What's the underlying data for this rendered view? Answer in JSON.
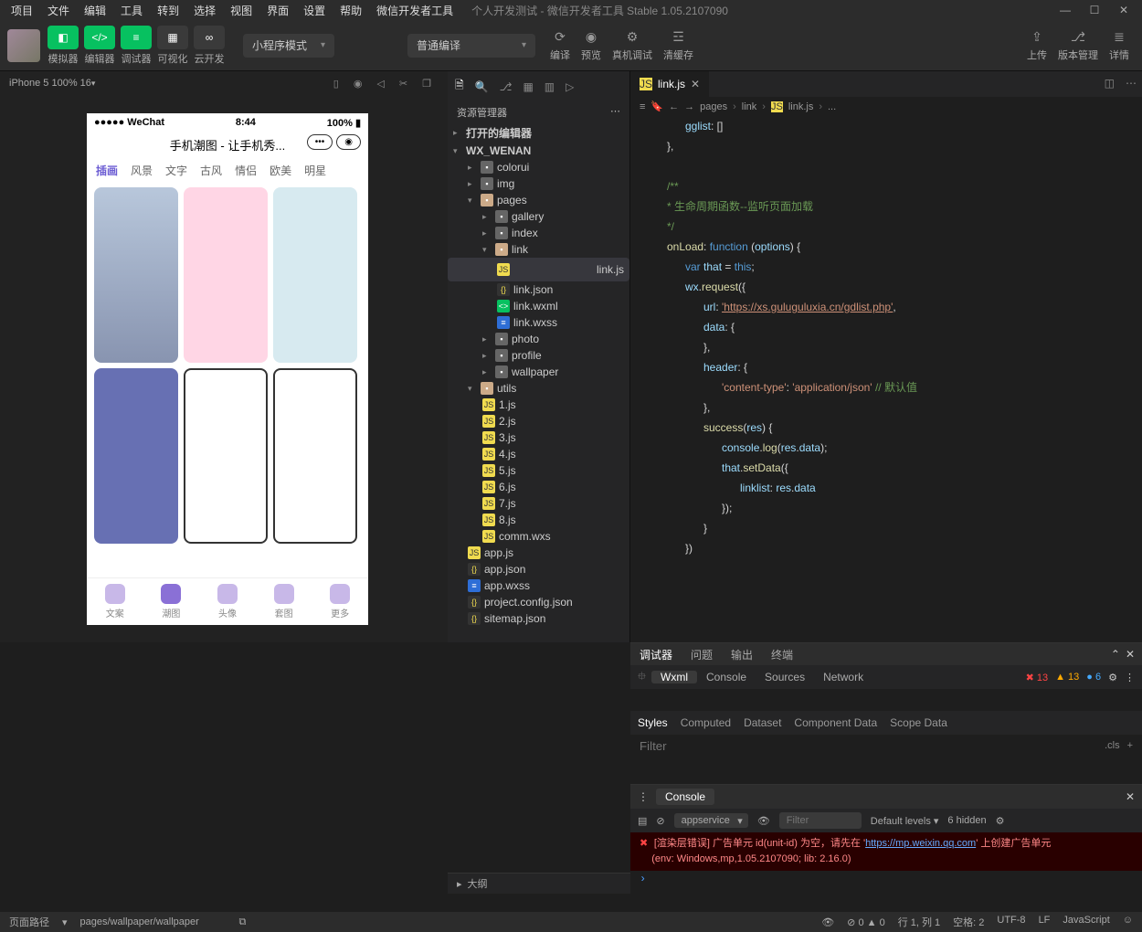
{
  "menu": [
    "项目",
    "文件",
    "编辑",
    "工具",
    "转到",
    "选择",
    "视图",
    "界面",
    "设置",
    "帮助",
    "微信开发者工具"
  ],
  "window_title": "个人开发测试 - 微信开发者工具 Stable 1.05.2107090",
  "toolbar": {
    "groups": [
      "模拟器",
      "编辑器",
      "调试器",
      "可视化",
      "云开发"
    ],
    "mode_select": "小程序模式",
    "compile_select": "普通编译",
    "center_btns": [
      "编译",
      "预览",
      "真机调试",
      "清缓存"
    ],
    "right_btns": [
      "上传",
      "版本管理",
      "详情"
    ]
  },
  "sim_header": "iPhone 5 100% 16",
  "phone": {
    "carrier": "●●●●● WeChat",
    "time": "8:44",
    "battery": "100%",
    "title": "手机潮图 - 让手机秀...",
    "tabs": [
      "插画",
      "风景",
      "文字",
      "古风",
      "情侣",
      "欧美",
      "明星"
    ],
    "tabbar": [
      "文案",
      "潮图",
      "头像",
      "套图",
      "更多"
    ]
  },
  "explorer": {
    "title": "资源管理器",
    "sections": {
      "opened": "打开的编辑器",
      "project": "WX_WENAN"
    },
    "colorui": "colorui",
    "img": "img",
    "pages": "pages",
    "gallery": "gallery",
    "index": "index",
    "link": "link",
    "linkjs": "link.js",
    "linkjson": "link.json",
    "linkwxml": "link.wxml",
    "linkwxss": "link.wxss",
    "photo": "photo",
    "profile": "profile",
    "wallpaper": "wallpaper",
    "utils": "utils",
    "u1": "1.js",
    "u2": "2.js",
    "u3": "3.js",
    "u4": "4.js",
    "u5": "5.js",
    "u6": "6.js",
    "u7": "7.js",
    "u8": "8.js",
    "comm": "comm.wxs",
    "appjs": "app.js",
    "appjson": "app.json",
    "appwxss": "app.wxss",
    "pconfig": "project.config.json",
    "sitemap": "sitemap.json"
  },
  "editor_tab": "link.js",
  "breadcrumb": [
    "pages",
    "link",
    "link.js",
    "..."
  ],
  "code": {
    "l1": "gglist",
    "l2": "/**",
    "l3": " * 生命周期函数--监听页面加载",
    "l4": " */",
    "l5": "onLoad",
    "l5b": "function",
    "l5c": "options",
    "l6a": "var",
    "l6b": "that",
    "l6c": "this",
    "l7a": "wx",
    "l7b": "request",
    "l8a": "url",
    "l8b": "'https://xs.guluguluxia.cn/gdlist.php'",
    "l9": "data",
    "l10": "header",
    "l11a": "'content-type'",
    "l11b": "'application/json'",
    "l11c": "// 默认值",
    "l12a": "success",
    "l12b": "res",
    "l13a": "console",
    "l13b": "log",
    "l13c": "res",
    "l13d": "data",
    "l14a": "that",
    "l14b": "setData",
    "l15a": "linklist",
    "l15b": "res",
    "l15c": "data"
  },
  "debugger": {
    "top_tabs": [
      "调试器",
      "问题",
      "输出",
      "终端"
    ],
    "sub_tabs": [
      "Wxml",
      "Console",
      "Sources",
      "Network"
    ],
    "err_count": "13",
    "warn_count": "13",
    "info_count": "6",
    "style_tabs": [
      "Styles",
      "Computed",
      "Dataset",
      "Component Data",
      "Scope Data"
    ],
    "filter_placeholder": "Filter",
    "cls": ".cls"
  },
  "console": {
    "title": "Console",
    "context": "appservice",
    "filter_placeholder": "Filter",
    "levels": "Default levels",
    "hidden": "6 hidden",
    "err1a": "[渲染层错误] 广告单元 id(unit-id) 为空，请先在 '",
    "err1b": "https://mp.weixin.qq.com",
    "err1c": "' 上创建广告单元",
    "err2": "(env: Windows,mp,1.05.2107090; lib: 2.16.0)"
  },
  "outline": "大纲",
  "status": {
    "label": "页面路径",
    "path": "pages/wallpaper/wallpaper",
    "problems": "0",
    "ln": "行 1, 列 1",
    "spaces": "空格: 2",
    "enc": "UTF-8",
    "eol": "LF",
    "lang": "JavaScript"
  }
}
